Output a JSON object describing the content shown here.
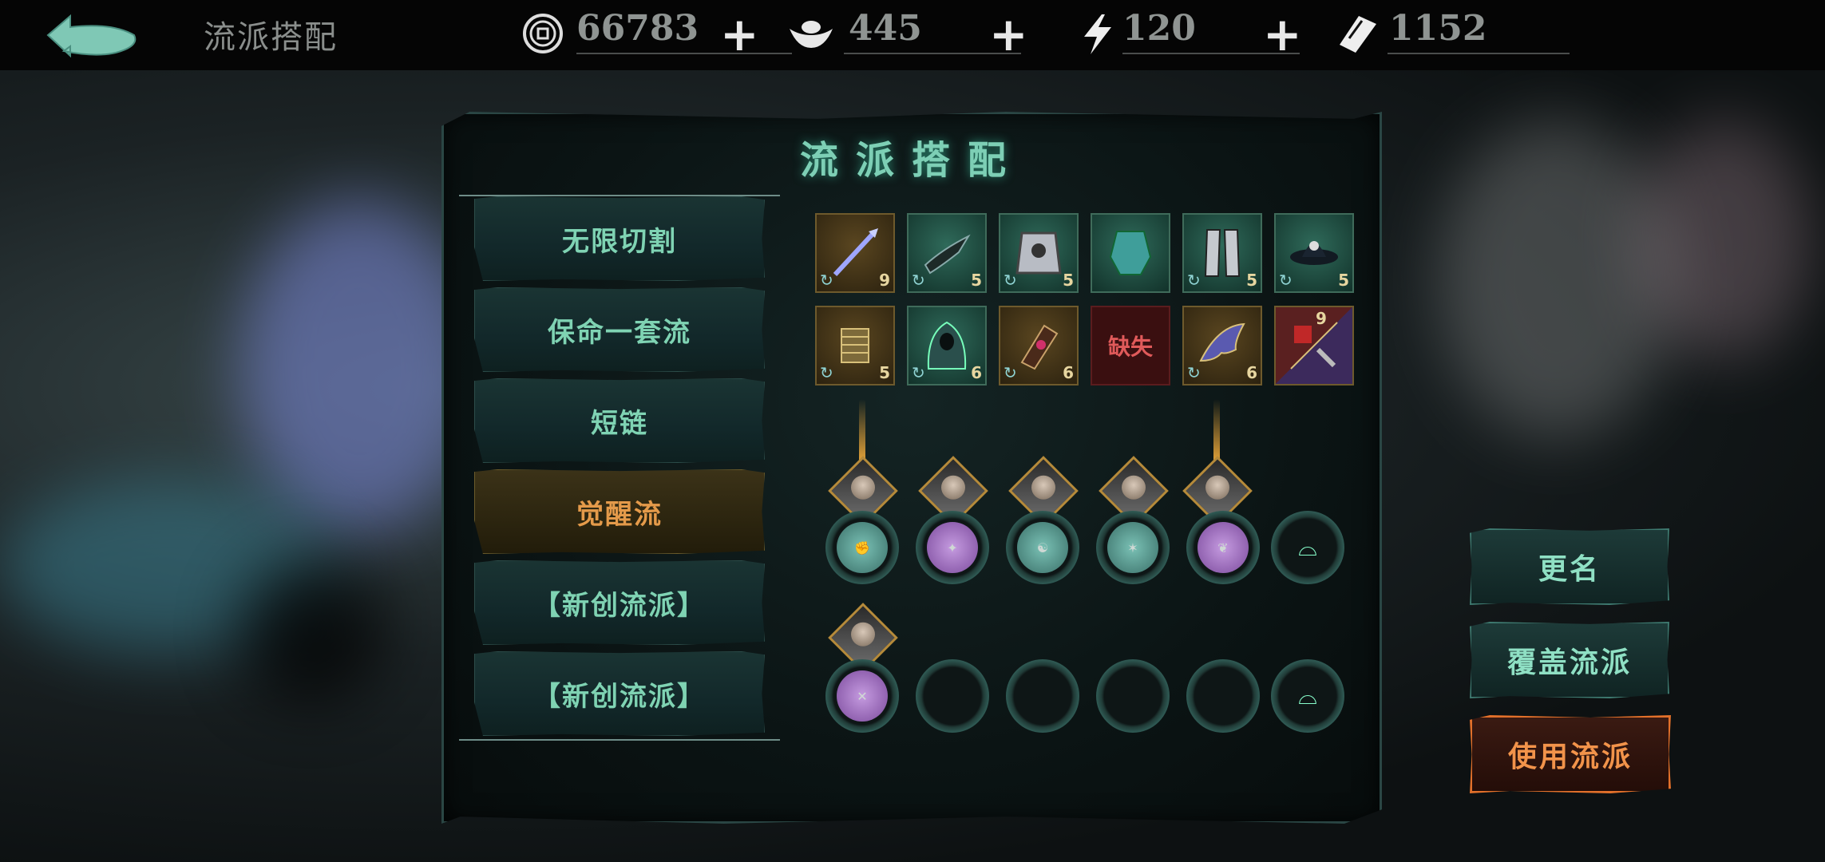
{
  "header": {
    "title": "流派搭配",
    "resources": [
      {
        "icon": "coin-icon",
        "value": "66783"
      },
      {
        "icon": "silver-ingot-icon",
        "value": "445"
      },
      {
        "icon": "lightning-icon",
        "value": "120"
      },
      {
        "icon": "ticket-icon",
        "value": "1152"
      }
    ],
    "plus_label": "+"
  },
  "panel": {
    "title": "流派搭配",
    "builds": [
      {
        "label": "无限切割",
        "active": false
      },
      {
        "label": "保命一套流",
        "active": false
      },
      {
        "label": "短链",
        "active": false
      },
      {
        "label": "觉醒流",
        "active": true
      },
      {
        "label": "【新创流派】",
        "active": false
      },
      {
        "label": "【新创流派】",
        "active": false
      }
    ],
    "equipment": [
      {
        "name": "spear-weapon",
        "level": "9",
        "style": "gold"
      },
      {
        "name": "blade-weapon",
        "level": "5",
        "style": "green"
      },
      {
        "name": "armor-chest",
        "level": "5",
        "style": "green"
      },
      {
        "name": "robe-armor",
        "level": "",
        "style": "green"
      },
      {
        "name": "leg-armor",
        "level": "5",
        "style": "green"
      },
      {
        "name": "hat-helmet",
        "level": "5",
        "style": "green"
      },
      {
        "name": "golden-chain",
        "level": "5",
        "style": "gold"
      },
      {
        "name": "hood-cloak",
        "level": "6",
        "style": "green"
      },
      {
        "name": "bracer",
        "level": "6",
        "style": "gold"
      },
      {
        "name": "missing",
        "level": "",
        "style": "missing",
        "label": "缺失"
      },
      {
        "name": "wing-accessory",
        "level": "6",
        "style": "gold"
      },
      {
        "name": "dual-item",
        "level": "9",
        "style": "purple"
      }
    ],
    "skill_row_1": [
      "teal",
      "purple",
      "teal",
      "teal",
      "purple",
      "empty-ring"
    ],
    "skill_row_2": [
      "purple",
      "empty",
      "empty",
      "empty",
      "empty",
      "empty-ring"
    ]
  },
  "actions": {
    "rename": "更名",
    "overwrite": "覆盖流派",
    "use": "使用流派"
  },
  "colors": {
    "accent_teal": "#7fd3b3",
    "accent_orange": "#f2934a",
    "missing_red": "#e05a5a"
  }
}
